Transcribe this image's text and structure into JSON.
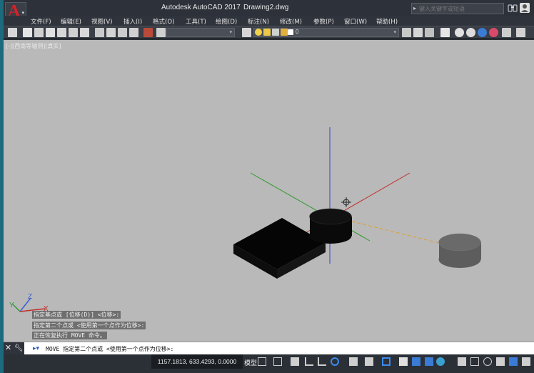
{
  "titlebar": {
    "app_title": "Autodesk AutoCAD 2017",
    "document": "Drawing2.dwg",
    "search_placeholder": "键入关键字或短语"
  },
  "menu": [
    {
      "label": "文件(F)"
    },
    {
      "label": "编辑(E)"
    },
    {
      "label": "视图(V)"
    },
    {
      "label": "插入(I)"
    },
    {
      "label": "格式(O)"
    },
    {
      "label": "工具(T)"
    },
    {
      "label": "绘图(D)"
    },
    {
      "label": "标注(N)"
    },
    {
      "label": "修改(M)"
    },
    {
      "label": "参数(P)"
    },
    {
      "label": "窗口(W)"
    },
    {
      "label": "帮助(H)"
    }
  ],
  "toolbar": {
    "layer_value": "0"
  },
  "viewport": {
    "label": "[-][西南等轴测][真实]",
    "ucs_x": "X",
    "ucs_y": "Y",
    "ucs_z": "Z"
  },
  "history": [
    "指定基点或 [位移(D)] <位移>:",
    "指定第二个点或 <使用第一个点作为位移>:",
    "正在恢复执行 MOVE 命令。"
  ],
  "command": {
    "text": "MOVE 指定第二个点或 <使用第一个点作为位移>:"
  },
  "status": {
    "coordinates": "1157.1813, 633.4293, 0.0000",
    "model": "模型"
  },
  "colors": {
    "x_axis": "#c0312b",
    "y_axis": "#2f9a2f",
    "z_axis": "#2f3fd0",
    "viewport_bg": "#b9b9b9",
    "logo_red": "#d2232a"
  }
}
